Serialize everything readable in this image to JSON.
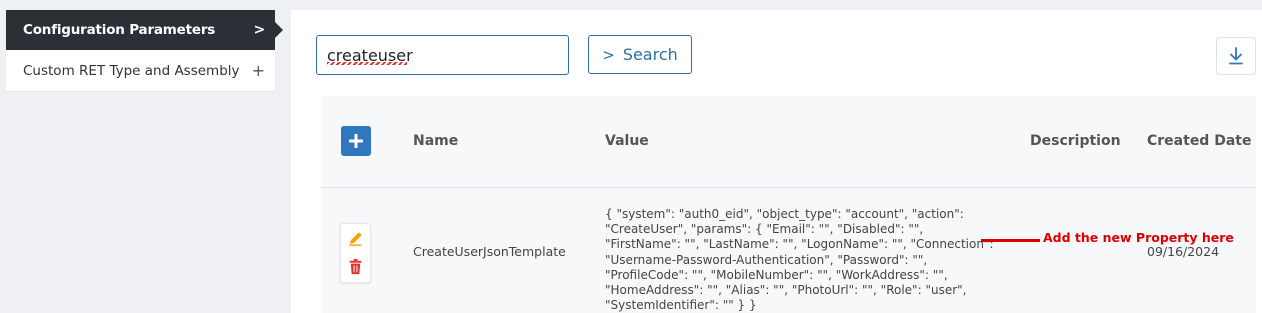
{
  "sidebar": {
    "items": [
      {
        "label": "Configuration Parameters",
        "icon": "chevron-right-icon",
        "symbol": ">",
        "active": true
      },
      {
        "label": "Custom RET Type and Assembly",
        "icon": "plus-icon",
        "symbol": "+",
        "active": false
      }
    ]
  },
  "search": {
    "value": "createuser",
    "button_label": "Search",
    "button_icon": "chevron-right-icon",
    "button_symbol": ">"
  },
  "toolbar": {
    "download_icon": "download-icon"
  },
  "table": {
    "add_icon": "plus-icon",
    "columns": [
      "Name",
      "Value",
      "Description",
      "Created Date"
    ],
    "rows": [
      {
        "name": "CreateUserJsonTemplate",
        "value": "{ \"system\": \"auth0_eid\", \"object_type\": \"account\", \"action\": \"CreateUser\", \"params\": { \"Email\": \"\", \"Disabled\": \"\", \"FirstName\": \"\", \"LastName\": \"\", \"LogonName\": \"\", \"Connection\": \"Username-Password-Authentication\", \"Password\": \"\", \"ProfileCode\": \"\", \"MobileNumber\": \"\", \"WorkAddress\": \"\", \"HomeAddress\": \"\", \"Alias\": \"\", \"PhotoUrl\": \"\", \"Role\": \"user\", \"SystemIdentifier\": \"\" } }",
        "description": "",
        "created_date": "09/16/2024",
        "actions": [
          "pencil-icon",
          "trash-icon"
        ]
      }
    ]
  },
  "annotation": {
    "text": "Add the new Property here",
    "color": "#dd0000"
  },
  "colors": {
    "accent": "#2f6fa4",
    "add_button": "#2f78bd",
    "nav_active": "#2b2f36",
    "edit_icon": "#f0a500",
    "delete_icon": "#e0342a"
  }
}
